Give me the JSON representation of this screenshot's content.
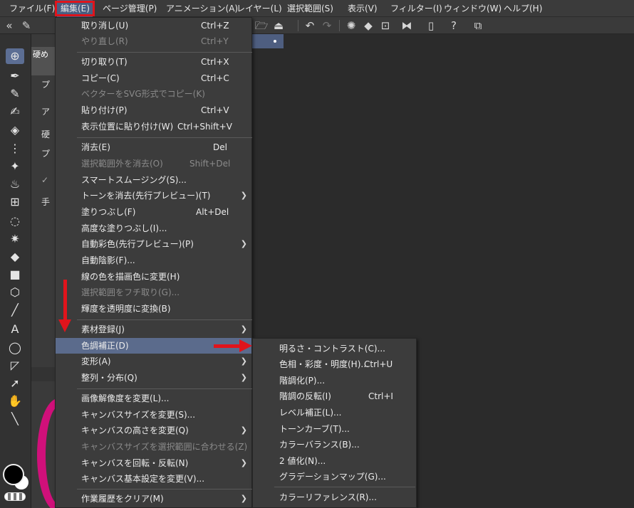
{
  "menubar": {
    "file": "ファイル(F)",
    "edit": "編集(E)",
    "page": "ページ管理(P)",
    "animation": "アニメーション(A)",
    "layer": "レイヤー(L)",
    "selection": "選択範囲(S)",
    "view": "表示(V)",
    "filter": "フィルター(I)",
    "window": "ウィンドウ(W)",
    "help": "ヘルプ(H)"
  },
  "toolbar": {
    "icons": [
      "collapse-icon",
      "pen-icon",
      "folder-open-icon",
      "export-icon",
      "undo-icon",
      "redo-icon",
      "loading-icon",
      "fill-icon",
      "transform-icon",
      "flip-icon",
      "device-icon",
      "help-icon",
      "settings-icon"
    ]
  },
  "subtool_panel": {
    "tab_label": "硬め",
    "text_lines": [
      "プ",
      "ア",
      "硬",
      "プ",
      "✓",
      "手"
    ]
  },
  "edit_menu": {
    "items": [
      {
        "label": "取り消し(U)",
        "shortcut": "Ctrl+Z",
        "disabled": false
      },
      {
        "label": "やり直し(R)",
        "shortcut": "Ctrl+Y",
        "disabled": true
      },
      {
        "label": "切り取り(T)",
        "shortcut": "Ctrl+X",
        "disabled": false
      },
      {
        "label": "コピー(C)",
        "shortcut": "Ctrl+C",
        "disabled": false
      },
      {
        "label": "ベクターをSVG形式でコピー(K)",
        "shortcut": "",
        "disabled": true
      },
      {
        "label": "貼り付け(P)",
        "shortcut": "Ctrl+V",
        "disabled": false
      },
      {
        "label": "表示位置に貼り付け(W)",
        "shortcut": "Ctrl+Shift+V",
        "disabled": false
      },
      {
        "label": "消去(E)",
        "shortcut": "Del",
        "disabled": false
      },
      {
        "label": "選択範囲外を消去(O)",
        "shortcut": "Shift+Del",
        "disabled": true
      },
      {
        "label": "スマートスムージング(S)...",
        "shortcut": "",
        "disabled": false
      },
      {
        "label": "トーンを消去(先行プレビュー)(T)",
        "shortcut": "",
        "disabled": false
      },
      {
        "label": "塗りつぶし(F)",
        "shortcut": "Alt+Del",
        "disabled": false
      },
      {
        "label": "高度な塗りつぶし(I)...",
        "shortcut": "",
        "disabled": false
      },
      {
        "label": "自動彩色(先行プレビュー)(P)",
        "shortcut": "",
        "disabled": false
      },
      {
        "label": "自動陰影(F)...",
        "shortcut": "",
        "disabled": false
      },
      {
        "label": "線の色を描画色に変更(H)",
        "shortcut": "",
        "disabled": false
      },
      {
        "label": "選択範囲をフチ取り(G)...",
        "shortcut": "",
        "disabled": true
      },
      {
        "label": "輝度を透明度に変換(B)",
        "shortcut": "",
        "disabled": false
      },
      {
        "label": "素材登録(J)",
        "shortcut": "",
        "disabled": false
      },
      {
        "label": "色調補正(D)",
        "shortcut": "",
        "disabled": false
      },
      {
        "label": "変形(A)",
        "shortcut": "",
        "disabled": false
      },
      {
        "label": "整列・分布(Q)",
        "shortcut": "",
        "disabled": false
      },
      {
        "label": "画像解像度を変更(L)...",
        "shortcut": "",
        "disabled": false
      },
      {
        "label": "キャンバスサイズを変更(S)...",
        "shortcut": "",
        "disabled": false
      },
      {
        "label": "キャンバスの高さを変更(Q)",
        "shortcut": "",
        "disabled": false
      },
      {
        "label": "キャンバスサイズを選択範囲に合わせる(Z)",
        "shortcut": "",
        "disabled": true
      },
      {
        "label": "キャンバスを回転・反転(N)",
        "shortcut": "",
        "disabled": false
      },
      {
        "label": "キャンバス基本設定を変更(V)...",
        "shortcut": "",
        "disabled": false
      },
      {
        "label": "作業履歴をクリア(M)",
        "shortcut": "",
        "disabled": false
      }
    ]
  },
  "color_submenu": {
    "items": [
      {
        "label": "明るさ・コントラスト(C)...",
        "shortcut": ""
      },
      {
        "label": "色相・彩度・明度(H)...",
        "shortcut": "Ctrl+U"
      },
      {
        "label": "階調化(P)...",
        "shortcut": ""
      },
      {
        "label": "階調の反転(I)",
        "shortcut": "Ctrl+I"
      },
      {
        "label": "レベル補正(L)...",
        "shortcut": ""
      },
      {
        "label": "トーンカーブ(T)...",
        "shortcut": ""
      },
      {
        "label": "カラーバランス(B)...",
        "shortcut": ""
      },
      {
        "label": "2 値化(N)...",
        "shortcut": ""
      },
      {
        "label": "グラデーションマップ(G)...",
        "shortcut": ""
      },
      {
        "label": "カラーリファレンス(R)...",
        "shortcut": ""
      }
    ]
  },
  "colors": {
    "highlight": "#5b6b8c",
    "annotation_red": "#e0141c",
    "menu_bg": "#3c3c3c"
  }
}
